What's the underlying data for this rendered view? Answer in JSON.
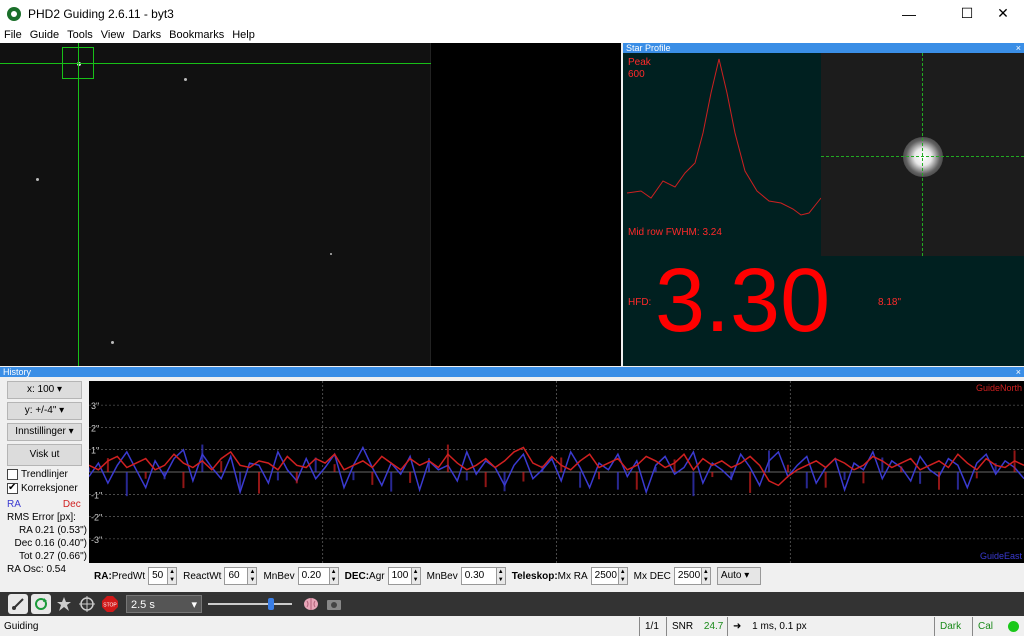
{
  "window": {
    "title": "PHD2 Guiding 2.6.11 - byt3",
    "controls": [
      "—",
      "☐",
      "✕"
    ]
  },
  "menu": [
    "File",
    "Guide",
    "Tools",
    "View",
    "Darks",
    "Bookmarks",
    "Help"
  ],
  "star_profile": {
    "title": "Star Profile",
    "close": "×",
    "peak_label": "Peak",
    "peak_value": "600",
    "fwhm_label": "Mid row FWHM: 3.24",
    "hfd_label": "HFD:",
    "hfd_value": "3.30",
    "hfd_arcsec": "8.18\"",
    "colors": {
      "text": "#ff0000",
      "background": "#002020"
    }
  },
  "history": {
    "title": "History",
    "close": "×",
    "x_button": "x: 100",
    "y_button": "y: +/-4\"",
    "settings_button": "Innstillinger",
    "clear_button": "Visk ut",
    "trend_checkbox": "Trendlinjer",
    "trend_checked": false,
    "corrections_checkbox": "Korreksjoner",
    "corrections_checked": true,
    "legend_ra": "RA",
    "legend_dec": "Dec",
    "rms_header": "RMS Error [px]:",
    "rms_ra": "RA 0.21 (0.53\")",
    "rms_dec": "Dec 0.16 (0.40\")",
    "rms_tot": "Tot 0.27 (0.66\")",
    "ra_osc": "RA Osc: 0.54",
    "label_north": "GuideNorth",
    "label_east": "GuideEast",
    "colors": {
      "ra": "#3a3ad0",
      "dec": "#d02020"
    }
  },
  "chart_data": {
    "type": "line",
    "ylim": [
      -4,
      4
    ],
    "y_tick_labels": [
      "3\"",
      "2\"",
      "1\"",
      "-1\"",
      "-2\"",
      "-3\""
    ],
    "series": [
      {
        "name": "RA",
        "values": [
          -0.2,
          0.4,
          -0.5,
          0.3,
          0.9,
          0.1,
          -0.7,
          0.5,
          -0.2,
          0.6,
          1.0,
          -0.4,
          0.8,
          0.2,
          -0.3,
          0.7,
          -0.9,
          0.4,
          0.3,
          -0.5,
          0.9,
          0.1,
          -0.4,
          0.6,
          -0.3,
          0.2,
          0.8,
          -0.7,
          0.3,
          1.1,
          0.2,
          -0.6,
          0.4,
          -0.1,
          0.7,
          -0.8,
          0.5,
          0.1,
          0.3,
          -0.4,
          0.9,
          -0.1,
          0.5,
          0.2,
          -0.6,
          0.3,
          0.8,
          -0.3,
          0.1,
          0.6,
          -0.4,
          0.9,
          0.2,
          -0.7,
          0.4,
          0.1,
          0.8,
          -0.2,
          0.5,
          -0.9,
          0.3,
          0.7,
          -0.1,
          0.2,
          0.9,
          -0.5,
          0.4,
          0.1,
          -0.3,
          0.8,
          0.2,
          -0.6,
          0.5,
          0.9,
          -0.2,
          0.3,
          0.7,
          -0.5,
          0.2,
          0.6,
          -0.8,
          0.4,
          0.1,
          0.9,
          -0.3,
          0.5,
          0.2,
          -0.4,
          0.7,
          0.1,
          -0.2,
          0.6,
          0.3,
          -0.7,
          0.4,
          0.8,
          -0.1,
          0.5,
          0.2,
          -0.3
        ]
      },
      {
        "name": "Dec",
        "values": [
          0.3,
          0.1,
          0.5,
          0.7,
          0.2,
          0.4,
          0.6,
          0.1,
          0.3,
          0.8,
          0.4,
          0.2,
          0.5,
          0.1,
          0.6,
          0.9,
          0.3,
          0.2,
          0.5,
          0.4,
          0.1,
          0.7,
          0.3,
          0.2,
          0.6,
          0.4,
          0.8,
          0.1,
          0.3,
          0.5,
          0.2,
          0.7,
          0.4,
          0.1,
          0.6,
          0.3,
          0.5,
          0.2,
          0.8,
          0.4,
          0.1,
          0.3,
          0.6,
          0.2,
          0.5,
          0.9,
          1.1,
          0.4,
          0.2,
          0.7,
          0.3,
          0.1,
          0.5,
          0.8,
          0.2,
          0.4,
          0.6,
          0.1,
          0.3,
          0.7,
          0.5,
          0.2,
          0.4,
          0.8,
          0.1,
          0.6,
          0.3,
          0.5,
          0.2,
          0.4,
          0.7,
          0.3,
          -0.4,
          -0.6,
          -0.2,
          0.1,
          0.3,
          0.5,
          0.2,
          0.6,
          0.4,
          0.1,
          0.3,
          0.7,
          0.5,
          0.2,
          0.4,
          0.6,
          0.1,
          0.3,
          0.5,
          0.2,
          0.8,
          0.4,
          0.1,
          0.6,
          0.3,
          0.2,
          0.5,
          0.3
        ]
      }
    ]
  },
  "params": {
    "ra_label": "RA:",
    "predwt_label": "PredWt",
    "predwt_value": "50",
    "reactwt_label": "ReactWt",
    "reactwt_value": "60",
    "mnbev_label": "MnBev",
    "mnbev_value": "0.20",
    "dec_label": "DEC:",
    "agr_label": "Agr",
    "agr_value": "100",
    "mnbev2_label": "MnBev",
    "mnbev2_value": "0.30",
    "telescope_label": "Teleskop:",
    "mxra_label": "Mx RA",
    "mxra_value": "2500",
    "mxdec_label": "Mx DEC",
    "mxdec_value": "2500",
    "mode_value": "Auto"
  },
  "toolbar": {
    "exposure": "2.5 s",
    "stop_label": "STOP",
    "icons": [
      "usb-icon",
      "loop-icon",
      "auto-select-star-icon",
      "guide-crosshair-icon",
      "stop-icon",
      "brain-icon",
      "camera-capture-icon"
    ]
  },
  "status": {
    "message": "Guiding",
    "frames": "1/1",
    "snr_label": "SNR",
    "snr_value": "24.7",
    "pulse": "1 ms, 0.1 px",
    "dark": "Dark",
    "cal": "Cal"
  }
}
